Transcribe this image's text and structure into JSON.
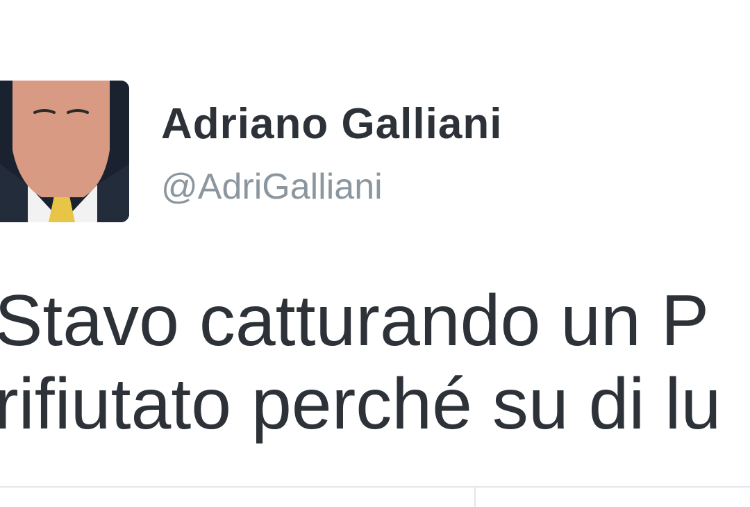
{
  "tweet": {
    "author": {
      "display_name": "Adriano Galliani",
      "handle": "@AdriGalliani",
      "avatar_icon": "cartoon-portrait-avatar"
    },
    "text_lines": [
      "Stavo catturando un P",
      "rifiutato perché su di lu"
    ]
  },
  "colors": {
    "name": "#2d3238",
    "handle": "#8b969e",
    "text": "#2d3238",
    "avatar_bg": "#1a2230",
    "avatar_face": "#d89a82",
    "avatar_tie": "#e8c547",
    "divider": "#e3e7ea"
  }
}
